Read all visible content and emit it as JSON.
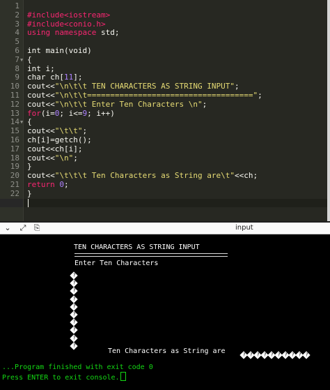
{
  "editor": {
    "line_numbers": [
      "1",
      "2",
      "3",
      "4",
      "5",
      "6",
      "7",
      "8",
      "9",
      "10",
      "11",
      "12",
      "13",
      "14",
      "15",
      "16",
      "17",
      "18",
      "19",
      "20",
      "21",
      "22",
      "23"
    ],
    "fold_markers": [
      "7",
      "14"
    ],
    "lines": [
      [],
      [
        {
          "t": "#include<iostream>",
          "c": "k"
        }
      ],
      [
        {
          "t": "#include<conio.h>",
          "c": "k"
        }
      ],
      [
        {
          "t": "using namespace",
          "c": "k"
        },
        {
          "t": " std;",
          "c": ""
        }
      ],
      [],
      [
        {
          "t": "int main(void)",
          "c": ""
        }
      ],
      [
        {
          "t": "{",
          "c": ""
        }
      ],
      [
        {
          "t": "int i;",
          "c": ""
        }
      ],
      [
        {
          "t": "char ch[",
          "c": ""
        },
        {
          "t": "11",
          "c": "n"
        },
        {
          "t": "];",
          "c": ""
        }
      ],
      [
        {
          "t": "cout<<",
          "c": ""
        },
        {
          "t": "\"\\n\\t\\t TEN CHARACTERS AS STRING INPUT\"",
          "c": "s"
        },
        {
          "t": ";",
          "c": ""
        }
      ],
      [
        {
          "t": "cout<<",
          "c": ""
        },
        {
          "t": "\"\\n\\t\\t====================================\"",
          "c": "s"
        },
        {
          "t": ";",
          "c": ""
        }
      ],
      [
        {
          "t": "cout<<",
          "c": ""
        },
        {
          "t": "\"\\n\\t\\t Enter Ten Characters \\n\"",
          "c": "s"
        },
        {
          "t": ";",
          "c": ""
        }
      ],
      [
        {
          "t": "for",
          "c": "k"
        },
        {
          "t": "(i=",
          "c": ""
        },
        {
          "t": "0",
          "c": "n"
        },
        {
          "t": "; i<=",
          "c": ""
        },
        {
          "t": "9",
          "c": "n"
        },
        {
          "t": "; i++)",
          "c": ""
        }
      ],
      [
        {
          "t": "{",
          "c": ""
        }
      ],
      [
        {
          "t": "cout<<",
          "c": ""
        },
        {
          "t": "\"\\t\\t\"",
          "c": "s"
        },
        {
          "t": ";",
          "c": ""
        }
      ],
      [
        {
          "t": "ch[i]=getch();",
          "c": ""
        }
      ],
      [
        {
          "t": "cout<<",
          "c": ""
        },
        {
          "t": "ch[i];",
          "c": ""
        }
      ],
      [
        {
          "t": "cout<<",
          "c": ""
        },
        {
          "t": "\"\\n\"",
          "c": "s"
        },
        {
          "t": ";",
          "c": ""
        }
      ],
      [
        {
          "t": "}",
          "c": ""
        }
      ],
      [
        {
          "t": "cout<<",
          "c": ""
        },
        {
          "t": "\"\\t\\t\\t Ten Characters as String are\\t\"",
          "c": "s"
        },
        {
          "t": "<<ch;",
          "c": ""
        }
      ],
      [
        {
          "t": "return ",
          "c": "k"
        },
        {
          "t": "0",
          "c": "n"
        },
        {
          "t": ";",
          "c": ""
        }
      ],
      [
        {
          "t": "}",
          "c": ""
        }
      ],
      []
    ]
  },
  "io_toolbar": {
    "icons": [
      "chevron-down-icon",
      "expand-icon",
      "copy-icon"
    ],
    "icon_glyphs": [
      "⌄",
      "⤢",
      "⎘"
    ],
    "label": "input"
  },
  "console": {
    "heading": "TEN CHARACTERS AS STRING INPUT",
    "prompt": "Enter Ten Characters",
    "char_count": 10,
    "result_label": "Ten Characters as String are",
    "finished": "...Program finished with exit code 0",
    "press_enter": "Press ENTER to exit console."
  },
  "colors": {
    "editor_bg": "#272822",
    "keyword": "#f92672",
    "string": "#e6db74",
    "number": "#ae81ff",
    "console_green": "#14d814"
  }
}
